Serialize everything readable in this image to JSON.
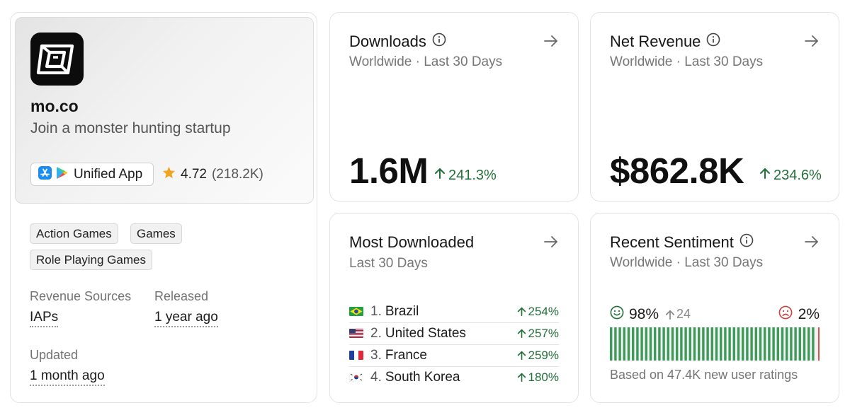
{
  "app": {
    "name": "mo.co",
    "subtitle": "Join a monster hunting startup",
    "icon": "mo-co-logo-icon",
    "platform_button": "Unified App",
    "rating": "4.72",
    "rating_count": "(218.2K)",
    "tags": [
      "Action Games",
      "Games",
      "Role Playing Games"
    ],
    "revenue_sources_label": "Revenue Sources",
    "revenue_sources_value": "IAPs",
    "released_label": "Released",
    "released_value": "1 year ago",
    "updated_label": "Updated",
    "updated_value": "1 month ago"
  },
  "downloads": {
    "title": "Downloads",
    "subtitle": "Worldwide · Last 30 Days",
    "value": "1.6M",
    "growth": "241.3%"
  },
  "revenue": {
    "title": "Net Revenue",
    "subtitle": "Worldwide · Last 30 Days",
    "value": "$862.8K",
    "growth": "234.6%"
  },
  "most_downloaded": {
    "title": "Most Downloaded",
    "subtitle": "Last 30 Days",
    "countries": [
      {
        "rank": "1.",
        "name": "Brazil",
        "growth": "254%",
        "flag": "brazil-flag-icon"
      },
      {
        "rank": "2.",
        "name": "United States",
        "growth": "257%",
        "flag": "us-flag-icon"
      },
      {
        "rank": "3.",
        "name": "France",
        "growth": "259%",
        "flag": "france-flag-icon"
      },
      {
        "rank": "4.",
        "name": "South Korea",
        "growth": "180%",
        "flag": "south-korea-flag-icon"
      }
    ]
  },
  "sentiment": {
    "title": "Recent Sentiment",
    "subtitle": "Worldwide · Last 30 Days",
    "positive": "98%",
    "positive_change": "24",
    "negative": "2%",
    "positive_share": 0.98,
    "note": "Based on 47.4K new user ratings"
  },
  "colors": {
    "positive": "#22703a",
    "bar_positive": "#3d9a5a",
    "bar_negative": "#d9534f"
  }
}
